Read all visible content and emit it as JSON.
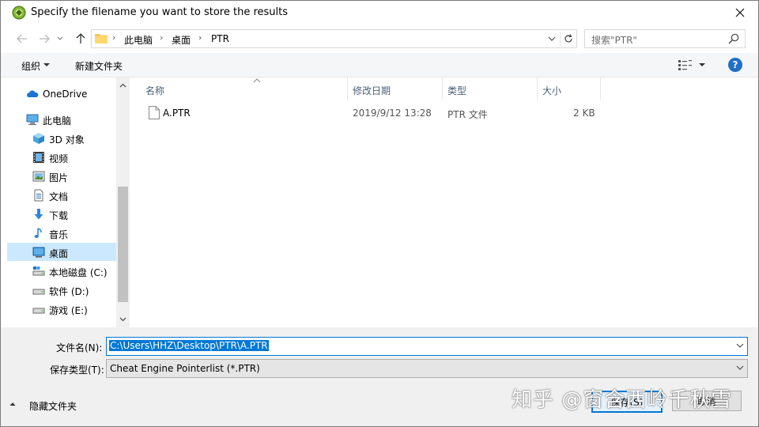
{
  "window": {
    "title": "Specify the filename you want to store the results"
  },
  "address": {
    "crumbs": [
      "此电脑",
      "桌面",
      "PTR"
    ],
    "search_placeholder": "搜索\"PTR\""
  },
  "toolbar": {
    "organize_label": "组织",
    "new_folder_label": "新建文件夹",
    "help_label": "?"
  },
  "nav": {
    "items": [
      {
        "label": "OneDrive",
        "icon": "cloud-icon"
      },
      {
        "label": "此电脑",
        "icon": "computer-icon"
      },
      {
        "label": "3D 对象",
        "icon": "cube-icon"
      },
      {
        "label": "视频",
        "icon": "video-icon"
      },
      {
        "label": "图片",
        "icon": "picture-icon"
      },
      {
        "label": "文档",
        "icon": "document-icon"
      },
      {
        "label": "下载",
        "icon": "download-icon"
      },
      {
        "label": "音乐",
        "icon": "music-icon"
      },
      {
        "label": "桌面",
        "icon": "desktop-icon"
      },
      {
        "label": "本地磁盘 (C:)",
        "icon": "drive-icon"
      },
      {
        "label": "软件 (D:)",
        "icon": "drive-icon"
      },
      {
        "label": "游戏 (E:)",
        "icon": "drive-icon"
      }
    ],
    "selected": "桌面"
  },
  "list": {
    "columns": [
      "名称",
      "修改日期",
      "类型",
      "大小"
    ],
    "rows": [
      {
        "name": "A.PTR",
        "modified": "2019/9/12 13:28",
        "type": "PTR 文件",
        "size": "2 KB"
      }
    ]
  },
  "bottom": {
    "filename_label": "文件名(N):",
    "filename_value": "C:\\Users\\HHZ\\Desktop\\PTR\\A.PTR",
    "filetype_label": "保存类型(T):",
    "filetype_value": "Cheat Engine Pointerlist (*.PTR)",
    "hide_folders_label": "隐藏文件夹",
    "save_label": "保存(S)",
    "cancel_label": "取消"
  },
  "watermark": {
    "text": "知乎 @窗含西岭千秋雪"
  },
  "colors": {
    "accent": "#0078d7",
    "selection": "#cce8ff",
    "toolbar_bg": "#f5f6f7",
    "bottom_bg": "#f0f0f0",
    "header_text": "#4c607a"
  }
}
